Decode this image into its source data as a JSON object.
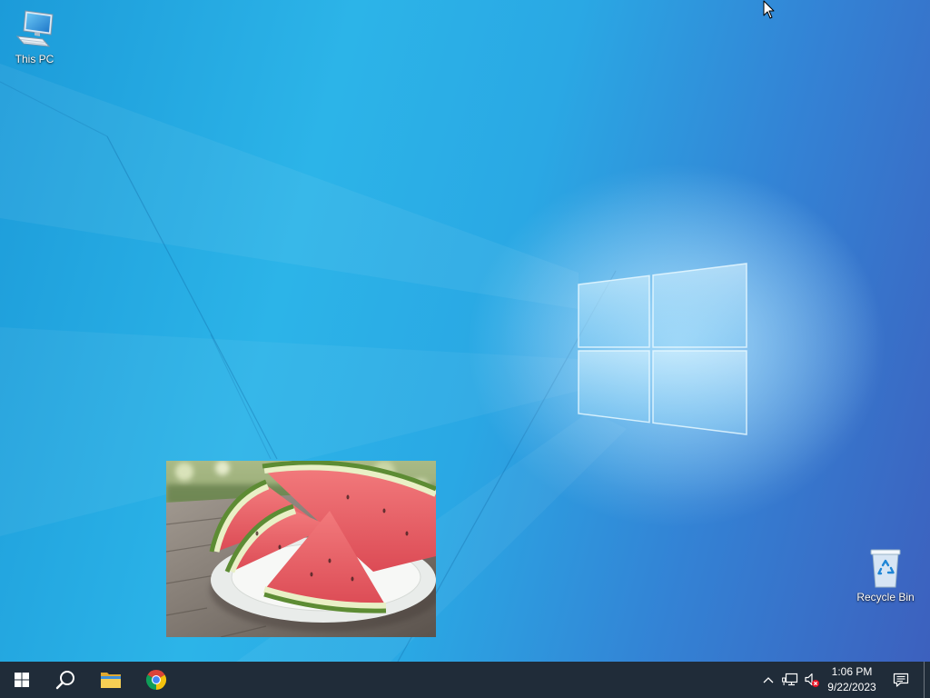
{
  "theme": {
    "wallpaper_light": "#2cb4e8",
    "wallpaper_dark": "#3d5fbd",
    "taskbar_bg": "#202c39",
    "text": "#ffffff",
    "mute_badge": "#e81123"
  },
  "desktop": {
    "icons": [
      {
        "label": "This PC",
        "icon": "this-pc-icon"
      },
      {
        "label": "Recycle Bin",
        "icon": "recycle-bin-icon"
      }
    ],
    "wallpaper_logo": "windows-logo-icon",
    "cursor": "arrow-cursor-icon"
  },
  "taskbar": {
    "start": {
      "icon": "windows-start-icon"
    },
    "pinned": [
      {
        "icon": "search-icon"
      },
      {
        "icon": "file-explorer-icon"
      },
      {
        "icon": "chrome-icon"
      }
    ],
    "tray": {
      "overflow_icon": "chevron-up-icon",
      "network_icon": "network-icon",
      "volume_icon": "volume-muted-icon",
      "time": "1:06 PM",
      "date": "9/22/2023",
      "notifications_icon": "action-center-icon"
    }
  }
}
